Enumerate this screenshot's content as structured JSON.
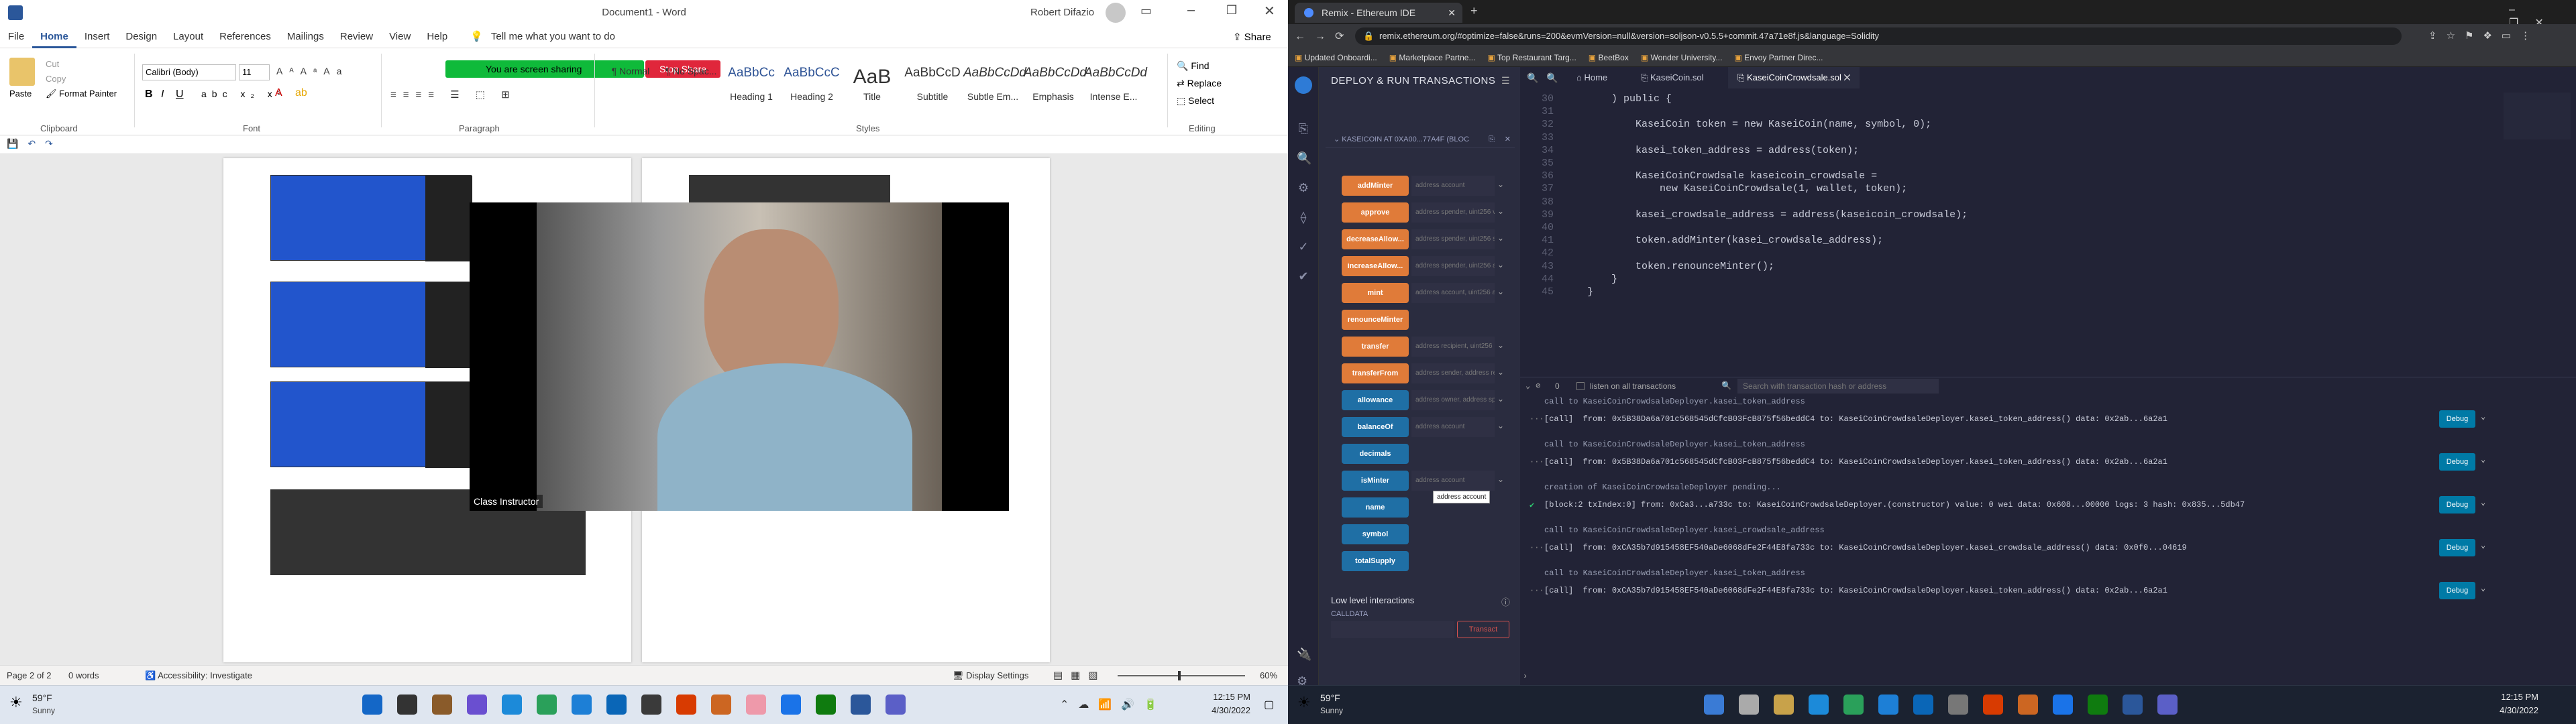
{
  "word": {
    "title": "Document1 - Word",
    "user": "Robert Difazio",
    "tabs": [
      "File",
      "Home",
      "Insert",
      "Design",
      "Layout",
      "References",
      "Mailings",
      "Review",
      "View",
      "Help"
    ],
    "active_tab": "Home",
    "tell_me": "Tell me what you want to do",
    "share": "Share",
    "clipboard": {
      "paste": "Paste",
      "cut": "Cut",
      "copy": "Copy",
      "format_painter": "Format Painter",
      "label": "Clipboard"
    },
    "font": {
      "name": "Calibri (Body)",
      "size": "11",
      "label": "Font"
    },
    "paragraph_label": "Paragraph",
    "sharing_banner": "You are screen sharing",
    "stop_share": "Stop Share",
    "styles": [
      {
        "preview": "¶ Normal",
        "name": ""
      },
      {
        "preview": "¶ No Spac...",
        "name": ""
      },
      {
        "preview": "AaBbCc",
        "name": "Heading 1"
      },
      {
        "preview": "AaBbCcC",
        "name": "Heading 2"
      },
      {
        "preview": "AaB",
        "name": "Title"
      },
      {
        "preview": "AaBbCcD",
        "name": "Subtitle"
      },
      {
        "preview": "AaBbCcDd",
        "name": "Subtle Em..."
      },
      {
        "preview": "AaBbCcDd",
        "name": "Emphasis"
      },
      {
        "preview": "AaBbCcDd",
        "name": "Intense E..."
      }
    ],
    "styles_label": "Styles",
    "editing": {
      "find": "Find",
      "replace": "Replace",
      "select": "Select",
      "label": "Editing"
    },
    "video_caption": "Class Instructor",
    "status": {
      "page": "Page 2 of 2",
      "words": "0 words",
      "accessibility": "Accessibility: Investigate",
      "display": "Display Settings",
      "zoom": "60%"
    }
  },
  "taskbar_left": {
    "temp": "59°F",
    "weather": "Sunny",
    "time": "12:15 PM",
    "date": "4/30/2022"
  },
  "taskbar_right": {
    "temp": "59°F",
    "weather": "Sunny",
    "time": "12:15 PM",
    "date": "4/30/2022"
  },
  "browser": {
    "tab_title": "Remix - Ethereum IDE",
    "url": "remix.ethereum.org/#optimize=false&runs=200&evmVersion=null&version=soljson-v0.5.5+commit.47a71e8f.js&language=Solidity",
    "bookmarks": [
      "Updated Onboardi...",
      "Marketplace Partne...",
      "Top Restaurant Targ...",
      "BeetBox",
      "Wonder University...",
      "Envoy Partner Direc..."
    ]
  },
  "remix": {
    "panel_title": "DEPLOY & RUN TRANSACTIONS",
    "contract": "KASEICOIN AT 0XA00...77A4F (BLOC",
    "functions": [
      {
        "name": "addMinter",
        "arg": "address account",
        "color": "#e07b39"
      },
      {
        "name": "approve",
        "arg": "address spender, uint256 v",
        "color": "#e07b39"
      },
      {
        "name": "decreaseAllow...",
        "arg": "address spender, uint256 s",
        "color": "#e07b39"
      },
      {
        "name": "increaseAllow...",
        "arg": "address spender, uint256 a",
        "color": "#e07b39"
      },
      {
        "name": "mint",
        "arg": "address account, uint256 a",
        "color": "#e07b39"
      },
      {
        "name": "renounceMinter",
        "arg": "",
        "color": "#e07b39"
      },
      {
        "name": "transfer",
        "arg": "address recipient, uint256",
        "color": "#e07b39"
      },
      {
        "name": "transferFrom",
        "arg": "address sender, address re",
        "color": "#e07b39"
      },
      {
        "name": "allowance",
        "arg": "address owner, address sp",
        "color": "#1f6fa5"
      },
      {
        "name": "balanceOf",
        "arg": "address account",
        "color": "#1f6fa5"
      },
      {
        "name": "decimals",
        "arg": "",
        "color": "#1f6fa5"
      },
      {
        "name": "isMinter",
        "arg": "address account",
        "color": "#1f6fa5"
      },
      {
        "name": "name",
        "arg": "",
        "color": "#1f6fa5"
      },
      {
        "name": "symbol",
        "arg": "",
        "color": "#1f6fa5"
      },
      {
        "name": "totalSupply",
        "arg": "",
        "color": "#1f6fa5"
      }
    ],
    "tooltip": "address account",
    "low_level": "Low level interactions",
    "calldata": "CALLDATA",
    "transact": "Transact",
    "tabs": [
      "Home",
      "KaseiCoin.sol",
      "KaseiCoinCrowdsale.sol"
    ],
    "code": [
      {
        "n": "30",
        "t": "    ) public {"
      },
      {
        "n": "31",
        "t": ""
      },
      {
        "n": "32",
        "t": "        KaseiCoin token = new KaseiCoin(name, symbol, 0);"
      },
      {
        "n": "33",
        "t": ""
      },
      {
        "n": "34",
        "t": "        kasei_token_address = address(token);"
      },
      {
        "n": "35",
        "t": ""
      },
      {
        "n": "36",
        "t": "        KaseiCoinCrowdsale kaseicoin_crowdsale ="
      },
      {
        "n": "37",
        "t": "            new KaseiCoinCrowdsale(1, wallet, token);"
      },
      {
        "n": "38",
        "t": ""
      },
      {
        "n": "39",
        "t": "        kasei_crowdsale_address = address(kaseicoin_crowdsale);"
      },
      {
        "n": "40",
        "t": ""
      },
      {
        "n": "41",
        "t": "        token.addMinter(kasei_crowdsale_address);"
      },
      {
        "n": "42",
        "t": ""
      },
      {
        "n": "43",
        "t": "        token.renounceMinter();"
      },
      {
        "n": "44",
        "t": "    }"
      },
      {
        "n": "45",
        "t": "}"
      }
    ],
    "term_count": "0",
    "listen": "listen on all transactions",
    "search_placeholder": "Search with transaction hash or address",
    "logs": [
      {
        "t": "call to KaseiCoinCrowdsaleDeployer.kasei_token_address",
        "debug": false
      },
      {
        "t": "[call]  from: 0x5B38Da6a701c568545dCfcB03FcB875f56beddC4 to: KaseiCoinCrowdsaleDeployer.kasei_token_address() data: 0x2ab...6a2a1",
        "debug": true
      },
      {
        "t": "call to KaseiCoinCrowdsaleDeployer.kasei_token_address",
        "debug": false
      },
      {
        "t": "[call]  from: 0x5B38Da6a701c568545dCfcB03FcB875f56beddC4 to: KaseiCoinCrowdsaleDeployer.kasei_token_address() data: 0x2ab...6a2a1",
        "debug": true
      },
      {
        "t": "creation of KaseiCoinCrowdsaleDeployer pending...",
        "debug": false
      },
      {
        "t": "[block:2 txIndex:0] from: 0xCa3...a733c to: KaseiCoinCrowdsaleDeployer.(constructor) value: 0 wei data: 0x608...00000 logs: 3 hash: 0x835...5db47",
        "debug": true
      },
      {
        "t": "call to KaseiCoinCrowdsaleDeployer.kasei_crowdsale_address",
        "debug": false
      },
      {
        "t": "[call]  from: 0xCA35b7d915458EF540aDe6068dFe2F44E8fa733c to: KaseiCoinCrowdsaleDeployer.kasei_crowdsale_address() data: 0x0f0...04619",
        "debug": true
      },
      {
        "t": "call to KaseiCoinCrowdsaleDeployer.kasei_token_address",
        "debug": false
      },
      {
        "t": "[call]  from: 0xCA35b7d915458EF540aDe6068dFe2F44E8fa733c to: KaseiCoinCrowdsaleDeployer.kasei_token_address() data: 0x2ab...6a2a1",
        "debug": true
      }
    ],
    "debug_label": "Debug"
  }
}
